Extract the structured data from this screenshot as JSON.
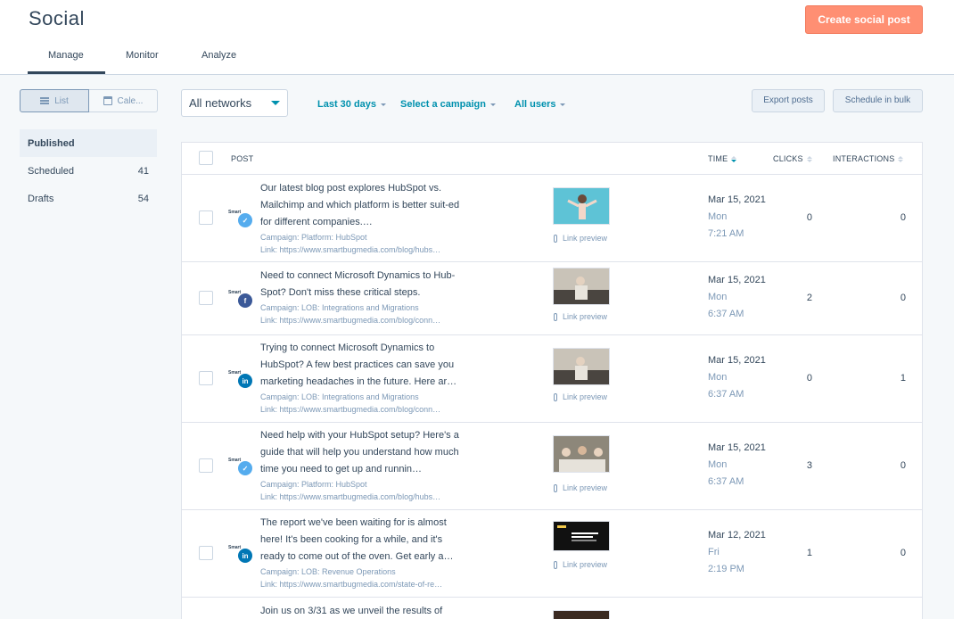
{
  "header": {
    "title": "Social",
    "create_button": "Create social post",
    "tabs": [
      {
        "label": "Manage",
        "active": true
      },
      {
        "label": "Monitor",
        "active": false
      },
      {
        "label": "Analyze",
        "active": false
      }
    ]
  },
  "view_toggle": {
    "list": "List",
    "calendar": "Cale..."
  },
  "sidebar": {
    "items": [
      {
        "label": "Published",
        "count": "",
        "active": true
      },
      {
        "label": "Scheduled",
        "count": "41",
        "active": false
      },
      {
        "label": "Drafts",
        "count": "54",
        "active": false
      }
    ]
  },
  "filters": {
    "network": "All networks",
    "date": "Last 30 days",
    "campaign": "Select a campaign",
    "users": "All users",
    "export": "Export posts",
    "bulk": "Schedule in bulk"
  },
  "table": {
    "columns": {
      "post": "POST",
      "time": "TIME",
      "clicks": "CLICKS",
      "interactions": "INTERACTIONS"
    },
    "rows": [
      {
        "network": "twitter",
        "text": "Our latest blog post explores HubSpot vs. Mailchimp and which platform is better suit-ed for different companies.…",
        "campaign": "Campaign: Platform: HubSpot",
        "link": "Link: https://www.smartbugmedia.com/blog/hubs…",
        "link_preview": "Link preview",
        "date": "Mar 15, 2021",
        "day": "Mon",
        "time": "7:21 AM",
        "clicks": "0",
        "interactions": "0"
      },
      {
        "network": "facebook",
        "text": "Need to connect Microsoft Dynamics to Hub-Spot? Don't miss these critical steps.",
        "campaign": "Campaign: LOB: Integrations and Migrations",
        "link": "Link: https://www.smartbugmedia.com/blog/conn…",
        "link_preview": "Link preview",
        "date": "Mar 15, 2021",
        "day": "Mon",
        "time": "6:37 AM",
        "clicks": "2",
        "interactions": "0"
      },
      {
        "network": "linkedin",
        "text": "Trying to connect Microsoft Dynamics to HubSpot? A few best practices can save you marketing headaches in the future. Here ar…",
        "campaign": "Campaign: LOB: Integrations and Migrations",
        "link": "Link: https://www.smartbugmedia.com/blog/conn…",
        "link_preview": "Link preview",
        "date": "Mar 15, 2021",
        "day": "Mon",
        "time": "6:37 AM",
        "clicks": "0",
        "interactions": "1"
      },
      {
        "network": "twitter",
        "text": "Need help with your HubSpot setup? Here's a guide that will help you understand how much time you need to get up and runnin…",
        "campaign": "Campaign: Platform: HubSpot",
        "link": "Link: https://www.smartbugmedia.com/blog/hubs…",
        "link_preview": "Link preview",
        "date": "Mar 15, 2021",
        "day": "Mon",
        "time": "6:37 AM",
        "clicks": "3",
        "interactions": "0"
      },
      {
        "network": "linkedin",
        "text": "The report we've been waiting for is almost here! It's been cooking for a while, and it's ready to come out of the oven. Get early a…",
        "campaign": "Campaign: LOB: Revenue Operations",
        "link": "Link: https://www.smartbugmedia.com/state-of-re…",
        "link_preview": "Link preview",
        "date": "Mar 12, 2021",
        "day": "Fri",
        "time": "2:19 PM",
        "clicks": "1",
        "interactions": "0"
      },
      {
        "network": "",
        "text": "Join us on 3/31 as we unveil the results of",
        "campaign": "",
        "link": "",
        "link_preview": "",
        "date": "",
        "day": "",
        "time": "",
        "clicks": "",
        "interactions": ""
      }
    ]
  },
  "colors": {
    "primary_button": "#ff8f73",
    "link": "#0091ae",
    "text": "#33475b",
    "muted": "#7c98b6"
  }
}
